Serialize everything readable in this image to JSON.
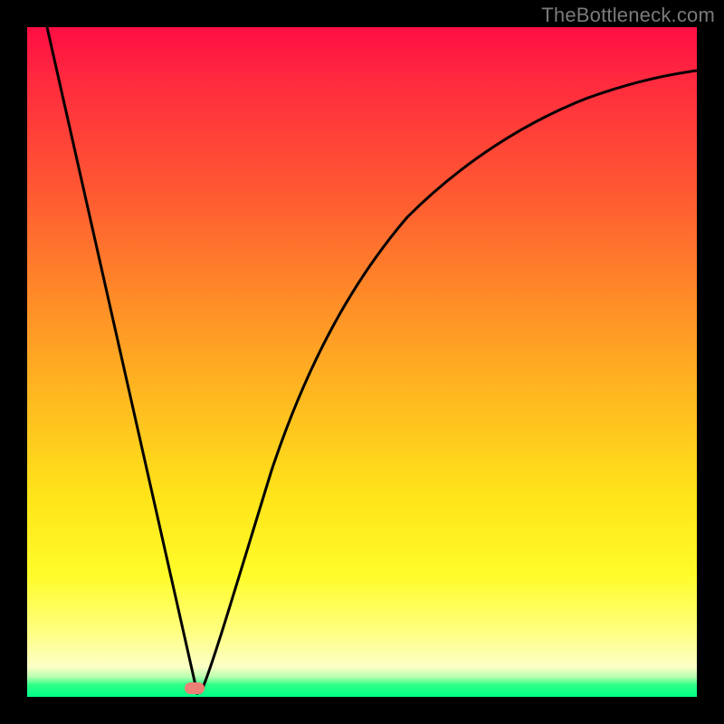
{
  "watermark": "TheBottleneck.com",
  "chart_data": {
    "type": "line",
    "title": "",
    "xlabel": "",
    "ylabel": "",
    "xlim": [
      0,
      100
    ],
    "ylim": [
      0,
      100
    ],
    "series": [
      {
        "name": "bottleneck-curve",
        "x": [
          3,
          8,
          14,
          18,
          21,
          23.6,
          25,
          25.5,
          26,
          26.5,
          27,
          29,
          32,
          36,
          42,
          50,
          60,
          72,
          86,
          100
        ],
        "y": [
          100,
          78,
          52,
          34,
          20,
          9,
          3,
          0.7,
          0,
          0.7,
          4,
          15,
          30,
          45,
          60,
          72,
          81,
          87,
          91,
          93
        ]
      }
    ],
    "marker": {
      "x": 25.3,
      "y": 0
    },
    "gradient_bands": [
      {
        "color": "#ff0e44",
        "stop": 0
      },
      {
        "color": "#ff5a32",
        "stop": 25
      },
      {
        "color": "#ffb820",
        "stop": 55
      },
      {
        "color": "#fffc2a",
        "stop": 82
      },
      {
        "color": "#fcffc6",
        "stop": 95
      },
      {
        "color": "#00ff88",
        "stop": 100
      }
    ]
  }
}
